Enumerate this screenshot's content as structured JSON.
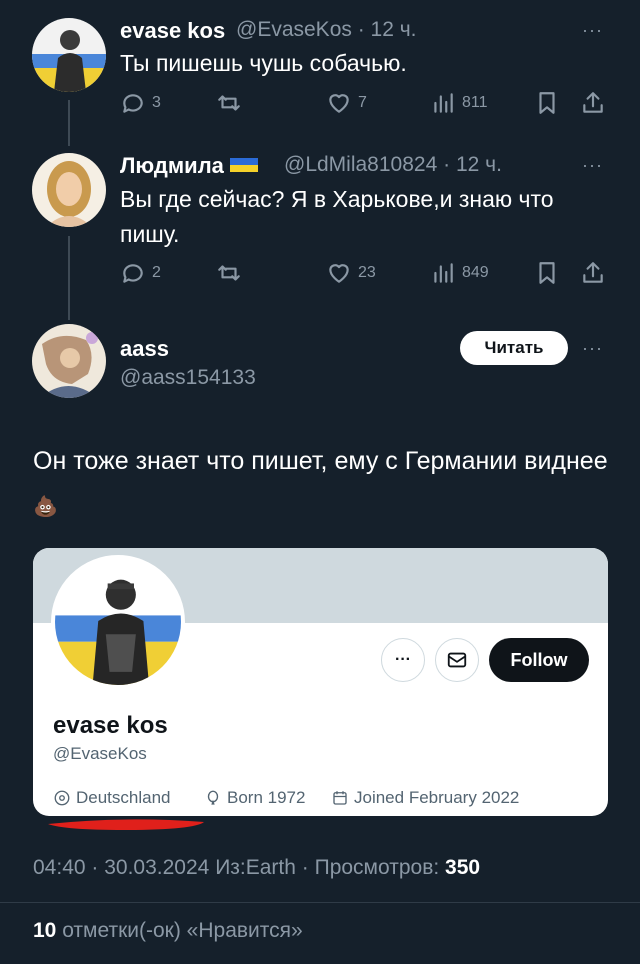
{
  "tweets": [
    {
      "name": "evase kos",
      "handle": "@EvaseKos",
      "time": "12 ч.",
      "text": "Ты пишешь чушь собачью.",
      "replies": "3",
      "likes": "7",
      "views": "811"
    },
    {
      "name": "Людмила",
      "handle": "@LdMila810824",
      "time": "12 ч.",
      "text": "Вы где сейчас? Я в Харькове,и знаю что пишу.",
      "replies": "2",
      "likes": "23",
      "views": "849"
    }
  ],
  "reply": {
    "name": "aass",
    "handle": "@aass154133",
    "read_button": "Читать",
    "text": "Он тоже знает что пишет, ему с Германии виднее",
    "emoji": "💩"
  },
  "profile_card": {
    "follow_label": "Follow",
    "more_label": "···",
    "name": "evase kos",
    "handle": "@EvaseKos",
    "location": "Deutschland",
    "born": "Born 1972",
    "joined": "Joined February 2022"
  },
  "footer": {
    "time": "04:40",
    "date": "30.03.2024",
    "source": "Из:Earth",
    "views_label": "Просмотров:",
    "views": "350",
    "likes_count": "10",
    "likes_label": "отметки(-ок) «Нравится»"
  },
  "colors": {
    "background": "#15202b",
    "secondary_text": "#8b98a5",
    "annotation_red": "#e0201b",
    "flag_blue": "#2b6bd6",
    "flag_yellow": "#f4d12a"
  }
}
